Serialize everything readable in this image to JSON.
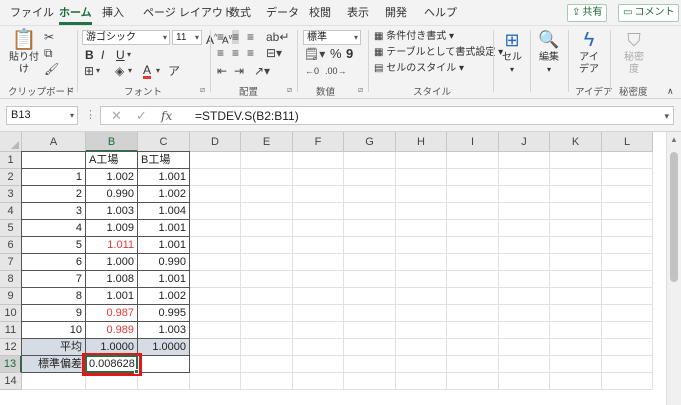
{
  "menu": {
    "tabs": [
      "ファイル",
      "ホーム",
      "挿入",
      "ページ レイアウト",
      "数式",
      "データ",
      "校閲",
      "表示",
      "開発",
      "ヘルプ"
    ],
    "share_label": "共有",
    "comment_label": "コメント"
  },
  "ribbon": {
    "clipboard": {
      "paste": "貼り付け",
      "label": "クリップボード"
    },
    "font": {
      "name": "游ゴシック",
      "size": "11",
      "label": "フォント",
      "bold": "B",
      "italic": "I",
      "underline": "U",
      "grow": "A",
      "shrink": "A",
      "font_color_letter": "A",
      "underline_color": "#e53935"
    },
    "alignment": {
      "label": "配置"
    },
    "number": {
      "format": "標準",
      "percent": "%",
      "comma": "9",
      "label": "数値"
    },
    "styles": {
      "conditional": "条件付き書式",
      "as_table": "テーブルとして書式設定",
      "cell_styles": "セルのスタイル",
      "label": "スタイル"
    },
    "cells": {
      "button": "セル"
    },
    "editing": {
      "button": "編集"
    },
    "ideas": {
      "button_line1": "アイ",
      "button_line2": "デア",
      "label": "アイデア"
    },
    "sensitivity": {
      "button_line1": "秘密",
      "button_line2": "度",
      "label": "秘密度"
    }
  },
  "formula_bar": {
    "name_box": "B13",
    "cancel": "✕",
    "enter": "✓",
    "fx": "fx",
    "formula": "=STDEV.S(B2:B11)"
  },
  "grid": {
    "columns": [
      "A",
      "B",
      "C",
      "D",
      "E",
      "F",
      "G",
      "H",
      "I",
      "J",
      "K",
      "L"
    ],
    "selected_column": "B",
    "selected_row": "13",
    "rows": [
      {
        "n": "1",
        "A": "",
        "B": "A工場",
        "C": "B工場",
        "red": false
      },
      {
        "n": "2",
        "A": "1",
        "B": "1.002",
        "C": "1.001",
        "red": false
      },
      {
        "n": "3",
        "A": "2",
        "B": "0.990",
        "C": "1.002",
        "red": false
      },
      {
        "n": "4",
        "A": "3",
        "B": "1.003",
        "C": "1.004",
        "red": false
      },
      {
        "n": "5",
        "A": "4",
        "B": "1.009",
        "C": "1.001",
        "red": false
      },
      {
        "n": "6",
        "A": "5",
        "B": "1.011",
        "C": "1.001",
        "red": true
      },
      {
        "n": "7",
        "A": "6",
        "B": "1.000",
        "C": "0.990",
        "red": false
      },
      {
        "n": "8",
        "A": "7",
        "B": "1.008",
        "C": "1.001",
        "red": false
      },
      {
        "n": "9",
        "A": "8",
        "B": "1.001",
        "C": "1.002",
        "red": false
      },
      {
        "n": "10",
        "A": "9",
        "B": "0.987",
        "C": "0.995",
        "red": true
      },
      {
        "n": "11",
        "A": "10",
        "B": "0.989",
        "C": "1.003",
        "red": true
      },
      {
        "n": "12",
        "A": "平均",
        "B": "1.0000",
        "C": "1.0000",
        "red": false
      },
      {
        "n": "13",
        "A": "標準偏差",
        "B": "0.008628",
        "C": "",
        "red": false
      },
      {
        "n": "14",
        "A": "",
        "B": "",
        "C": "",
        "red": false
      }
    ]
  },
  "colors": {
    "accent": "#217346",
    "red_value": "#e53935",
    "highlight": "#e8141b",
    "summary_fill": "#d6dce4"
  }
}
